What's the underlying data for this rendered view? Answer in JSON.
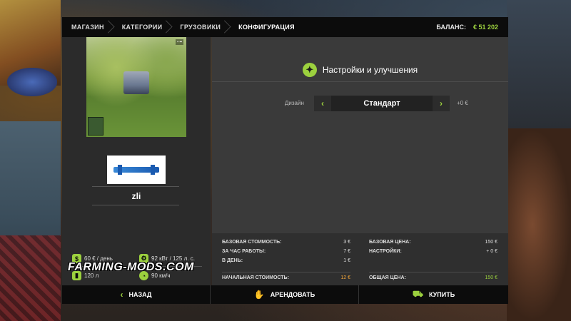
{
  "breadcrumbs": [
    "МАГАЗИН",
    "КАТЕГОРИИ",
    "ГРУЗОВИКИ",
    "КОНФИГУРАЦИЯ"
  ],
  "balance": {
    "label": "БАЛАНС:",
    "value": "€ 51 202"
  },
  "vehicle": {
    "name": "zli"
  },
  "stats": {
    "cost_per_day": "60 € / день",
    "power": "92 кВт / 125 л. с.",
    "fuel": "120 л",
    "speed": "90 км/ч"
  },
  "watermark": "FARMING-MODS.COM",
  "settings": {
    "title": "Настройки и улучшения",
    "design_label": "Дизайн",
    "design_value": "Стандарт",
    "design_price": "+0 €"
  },
  "costs": {
    "left": [
      {
        "label": "БАЗОВАЯ СТОИМОСТЬ:",
        "value": "3 €"
      },
      {
        "label": "ЗА ЧАС РАБОТЫ:",
        "value": "7 €"
      },
      {
        "label": "В ДЕНЬ:",
        "value": "1 €"
      }
    ],
    "left_total": {
      "label": "НАЧАЛЬНАЯ СТОИМОСТЬ:",
      "value": "12 €"
    },
    "right": [
      {
        "label": "БАЗОВАЯ ЦЕНА:",
        "value": "150 €"
      },
      {
        "label": "НАСТРОЙКИ:",
        "value": "+ 0 €"
      }
    ],
    "right_total": {
      "label": "ОБЩАЯ ЦЕНА:",
      "value": "150 €"
    }
  },
  "buttons": {
    "back": "НАЗАД",
    "lease": "АРЕНДОВАТЬ",
    "buy": "КУПИТЬ"
  },
  "colors": {
    "accent": "#9cd13e",
    "orange": "#f2a63a",
    "bar": "#0c0c0c",
    "panel": "#3a3a3a"
  },
  "icons": {
    "cost": "money-icon",
    "power": "engine-icon",
    "fuel": "fuel-icon",
    "speed": "speedometer-icon",
    "settings": "gear-icon",
    "back": "chevron-left-icon",
    "lease": "lease-icon",
    "buy": "cart-icon"
  }
}
